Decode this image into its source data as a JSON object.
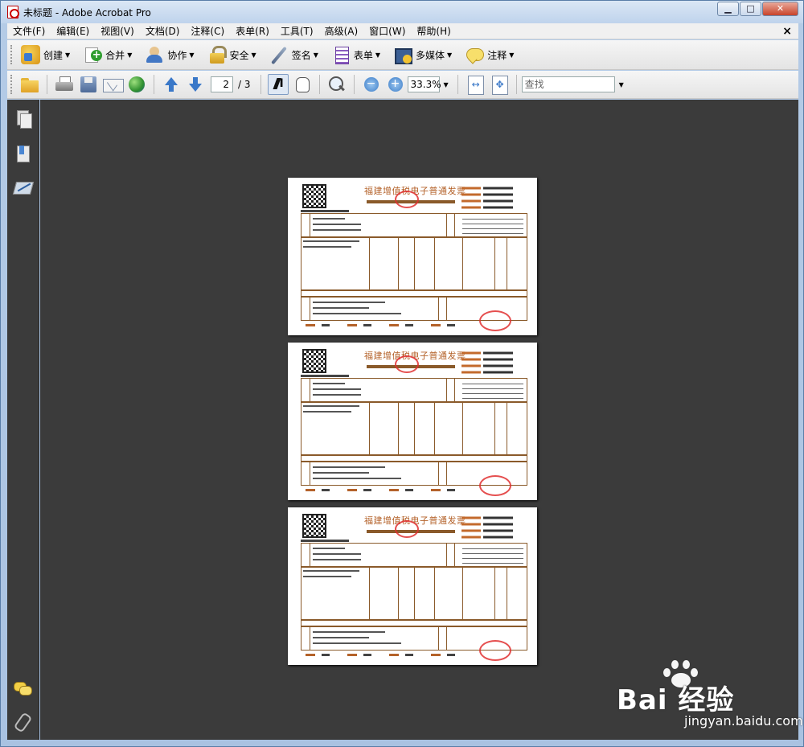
{
  "window": {
    "title": "未标题 - Adobe Acrobat Pro",
    "minimize": "▁",
    "maximize": "□",
    "close": "✕"
  },
  "menu": {
    "items": [
      "文件(F)",
      "编辑(E)",
      "视图(V)",
      "文档(D)",
      "注释(C)",
      "表单(R)",
      "工具(T)",
      "高级(A)",
      "窗口(W)",
      "帮助(H)"
    ],
    "close": "×"
  },
  "tasks": {
    "create": "创建",
    "combine": "合并",
    "collaborate": "协作",
    "secure": "安全",
    "sign": "签名",
    "forms": "表单",
    "multimedia": "多媒体",
    "comment": "注释"
  },
  "nav": {
    "current_page": "2",
    "total_pages": "/ 3",
    "zoom": "33.3%"
  },
  "search": {
    "placeholder": "查找"
  },
  "document": {
    "invoice_title": "福建增值税电子普通发票",
    "page_count": 3
  },
  "watermark": {
    "logo": "Bai 经验",
    "url": "jingyan.baidu.com"
  }
}
